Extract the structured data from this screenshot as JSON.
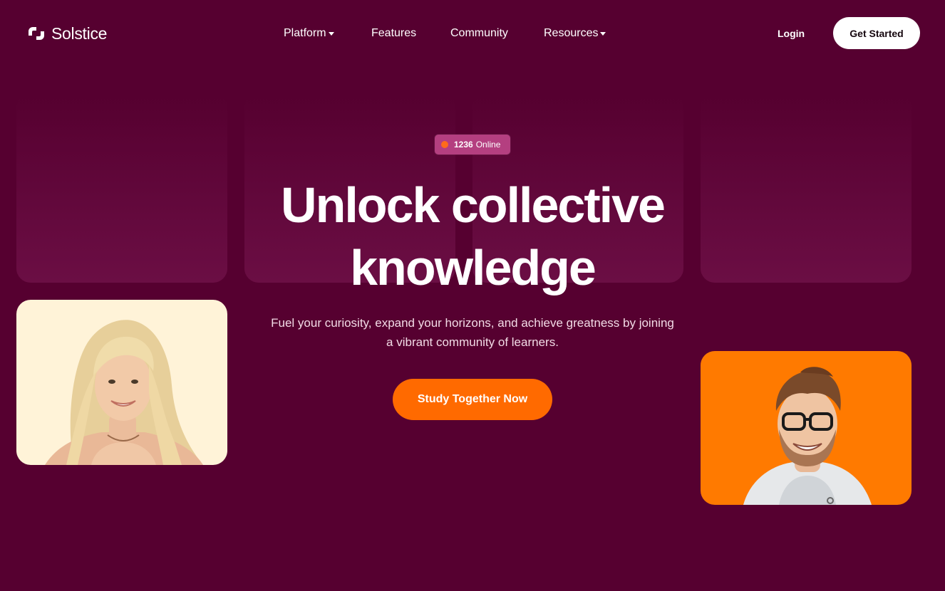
{
  "brand": {
    "name": "Solstice"
  },
  "nav": {
    "items": [
      {
        "label": "Platform",
        "has_dropdown": true
      },
      {
        "label": "Features",
        "has_dropdown": false
      },
      {
        "label": "Community",
        "has_dropdown": false
      },
      {
        "label": "Resources",
        "has_dropdown": true
      }
    ]
  },
  "header": {
    "login_label": "Login",
    "get_started_label": "Get Started"
  },
  "hero": {
    "online_count": "1236",
    "online_label": "Online",
    "title_line1": "Unlock collective",
    "title_line2": "knowledge",
    "subtitle": "Fuel your curiosity, expand your horizons, and achieve greatness by joining a vibrant community of learners.",
    "cta_label": "Study Together Now"
  },
  "icons": {
    "logo": "solstice-logo-icon",
    "dropdown": "chevron-down-icon",
    "status": "online-dot-icon"
  },
  "colors": {
    "background": "#560030",
    "accent": "#ff6a00",
    "badge": "#b43f80",
    "tile": "#6b0e44",
    "woman_photo_bg": "#fff3d8",
    "man_photo_bg": "#ff7a00"
  }
}
